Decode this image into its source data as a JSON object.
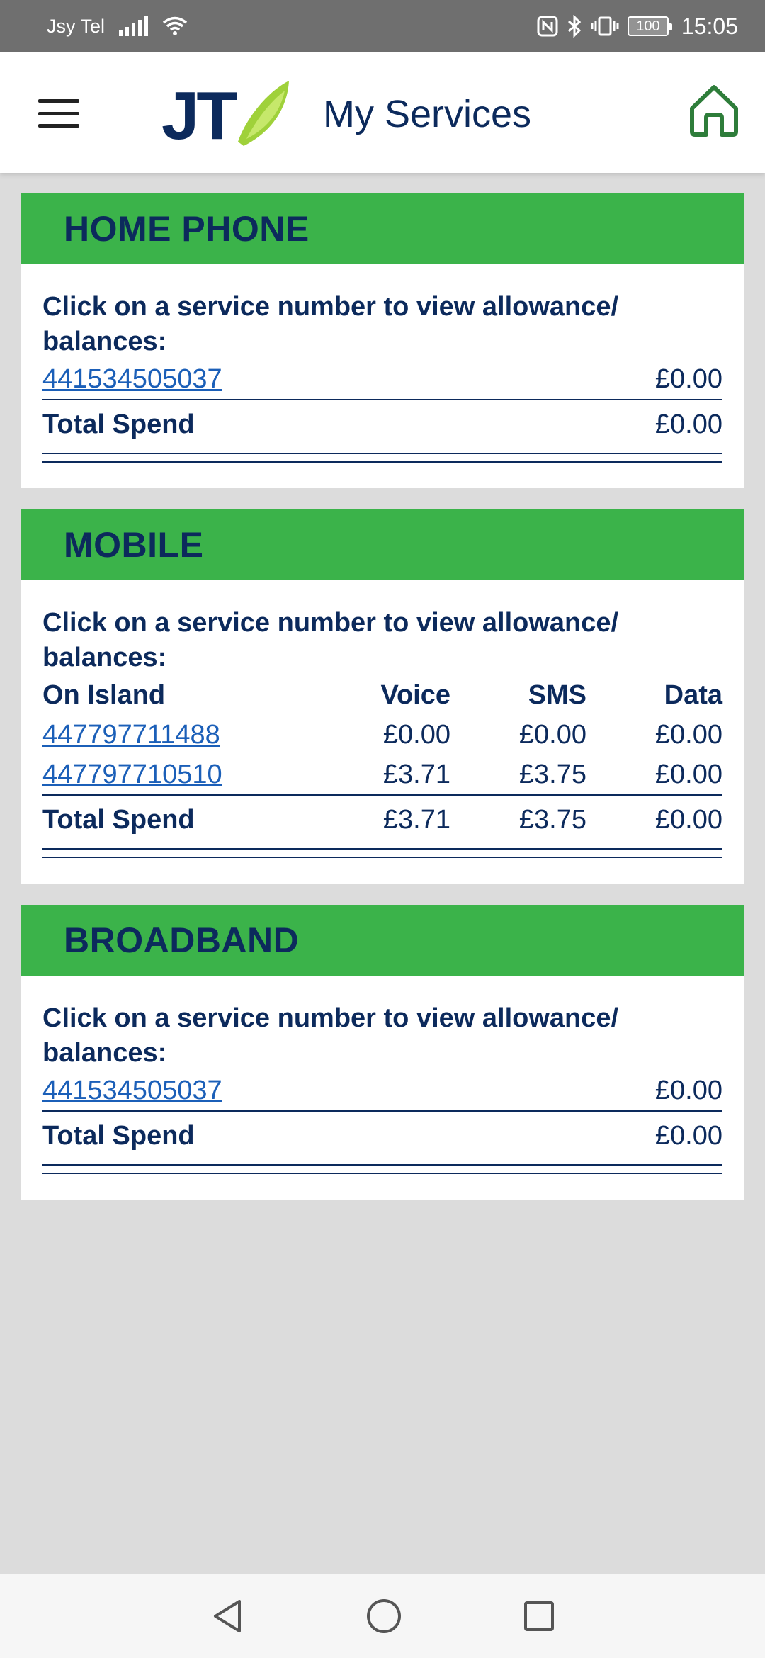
{
  "status_bar": {
    "carrier": "Jsy Tel",
    "battery": "100",
    "time": "15:05"
  },
  "header": {
    "logo_text": "JT",
    "title": "My Services"
  },
  "colors": {
    "accent_green": "#3bb34a",
    "navy": "#0c2a5c",
    "link_blue": "#1b5fb8"
  },
  "home_phone": {
    "title": "HOME PHONE",
    "instruction": "Click on a service number to view allowance/ balances:",
    "services": [
      {
        "number": "441534505037",
        "amount": "£0.00"
      }
    ],
    "total_label": "Total Spend",
    "total_amount": "£0.00"
  },
  "mobile": {
    "title": "MOBILE",
    "instruction": "Click on a service number to view allowance/ balances:",
    "columns": [
      "On Island",
      "Voice",
      "SMS",
      "Data"
    ],
    "services": [
      {
        "number": "447797711488",
        "voice": "£0.00",
        "sms": "£0.00",
        "data": "£0.00"
      },
      {
        "number": "447797710510",
        "voice": "£3.71",
        "sms": "£3.75",
        "data": "£0.00"
      }
    ],
    "total_label": "Total Spend",
    "total_voice": "£3.71",
    "total_sms": "£3.75",
    "total_data": "£0.00"
  },
  "broadband": {
    "title": "BROADBAND",
    "instruction": "Click on a service number to view allowance/ balances:",
    "services": [
      {
        "number": "441534505037",
        "amount": "£0.00"
      }
    ],
    "total_label": "Total Spend",
    "total_amount": "£0.00"
  }
}
